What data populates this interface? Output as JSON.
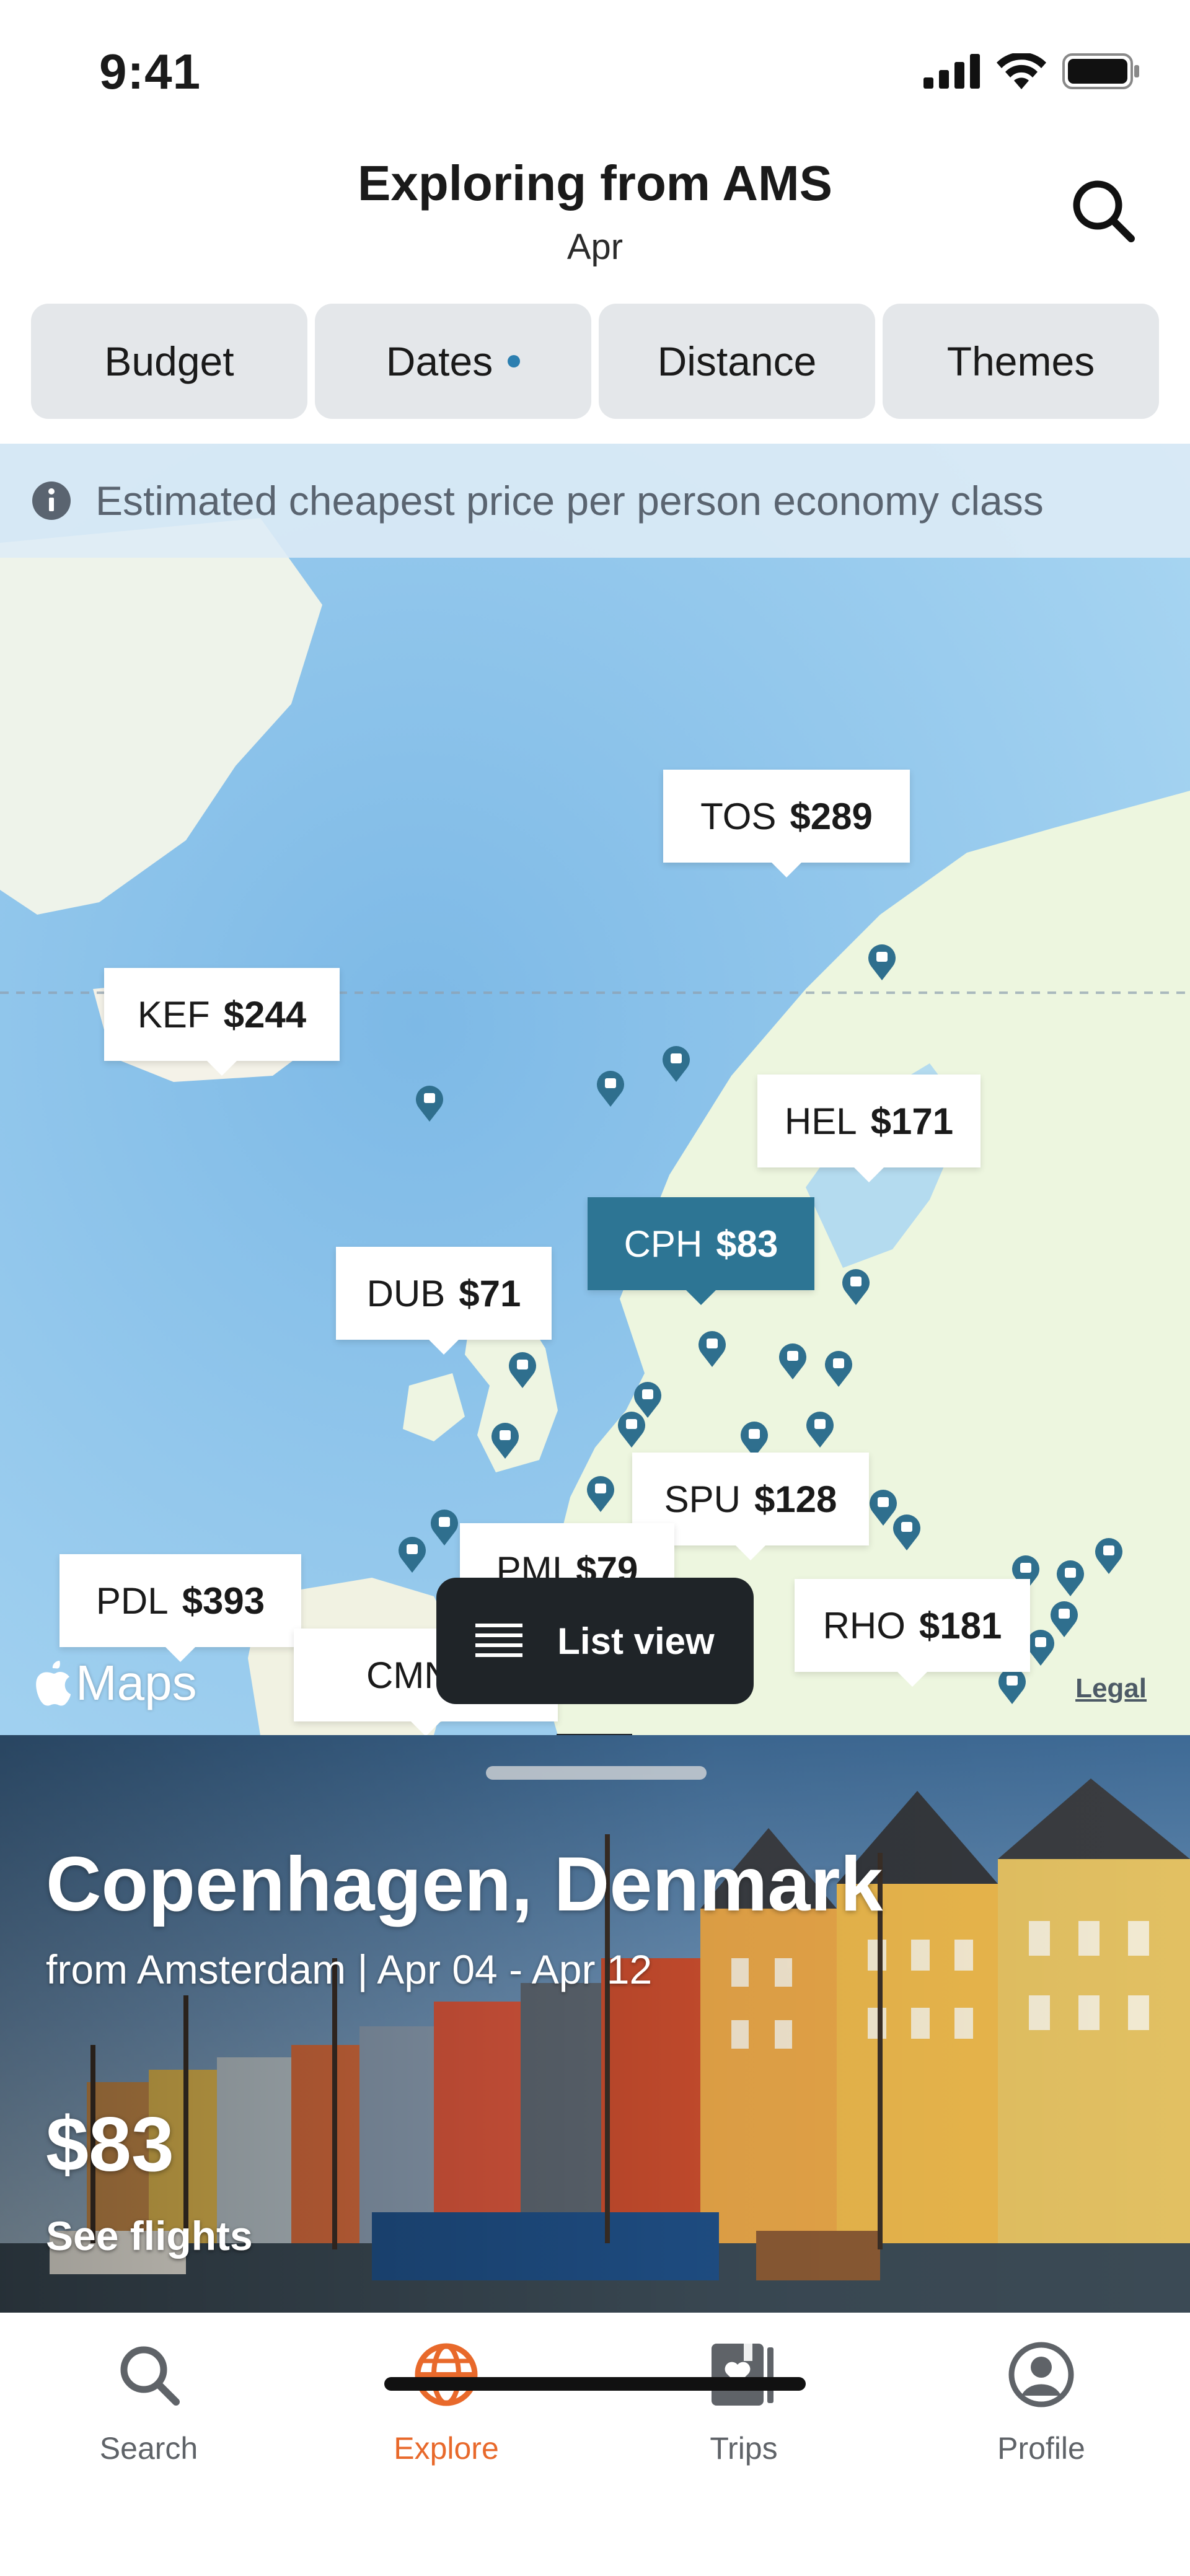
{
  "status_bar": {
    "time": "9:41"
  },
  "header": {
    "title": "Exploring from AMS",
    "subtitle": "Apr"
  },
  "filters": [
    {
      "label": "Budget",
      "active_dot": false
    },
    {
      "label": "Dates",
      "active_dot": true
    },
    {
      "label": "Distance",
      "active_dot": false
    },
    {
      "label": "Themes",
      "active_dot": false
    }
  ],
  "map": {
    "info_text": "Estimated cheapest price per person economy class",
    "price_labels": [
      {
        "code": "TOS",
        "price": "$289",
        "selected": false
      },
      {
        "code": "KEF",
        "price": "$244",
        "selected": false
      },
      {
        "code": "HEL",
        "price": "$171",
        "selected": false
      },
      {
        "code": "CPH",
        "price": "$83",
        "selected": true
      },
      {
        "code": "DUB",
        "price": "$71",
        "selected": false
      },
      {
        "code": "SPU",
        "price": "$128",
        "selected": false
      },
      {
        "code": "PMI",
        "price": "$79",
        "selected": false
      },
      {
        "code": "PDL",
        "price": "$393",
        "selected": false
      },
      {
        "code": "RHO",
        "price": "$181",
        "selected": false
      },
      {
        "code": "CMN",
        "price": "$",
        "selected": false
      }
    ],
    "maps_logo": "Maps",
    "legal": "Legal",
    "list_view_label": "List view"
  },
  "card": {
    "title": "Copenhagen, Denmark",
    "subtitle": "from Amsterdam | Apr 04 - Apr 12",
    "price": "$83",
    "link": "See flights"
  },
  "tabs": [
    {
      "label": "Search",
      "icon": "search-icon",
      "active": false
    },
    {
      "label": "Explore",
      "icon": "globe-icon",
      "active": true
    },
    {
      "label": "Trips",
      "icon": "passport-icon",
      "active": false
    },
    {
      "label": "Profile",
      "icon": "profile-icon",
      "active": false
    }
  ],
  "colors": {
    "accent": "#e8692b",
    "selected_label": "#2d7594",
    "dark_button": "#1f2428",
    "pin": "#2f6f8e"
  }
}
